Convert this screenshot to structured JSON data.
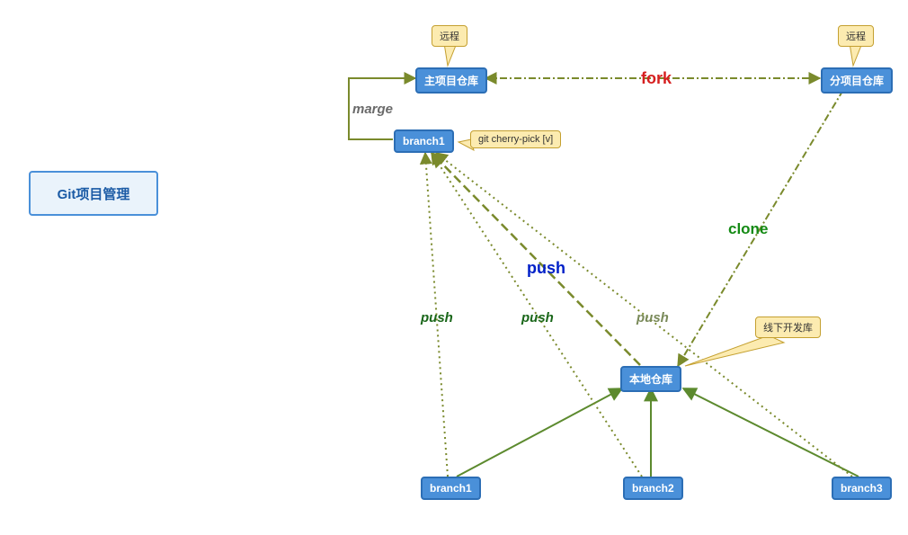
{
  "title": "Git项目管理",
  "nodes": {
    "main_repo": "主项目仓库",
    "sub_repo": "分项目仓库",
    "branch1_top": "branch1",
    "local_repo": "本地仓库",
    "branch1_bottom": "branch1",
    "branch2_bottom": "branch2",
    "branch3_bottom": "branch3"
  },
  "callouts": {
    "remote1": "远程",
    "remote2": "远程",
    "cherry_pick": "git cherry-pick [v]",
    "offline_dev": "线下开发库"
  },
  "edges": {
    "fork": "fork",
    "clone": "clone",
    "push_big": "push",
    "push1": "push",
    "push2": "push",
    "push3": "push",
    "marge": "marge"
  }
}
